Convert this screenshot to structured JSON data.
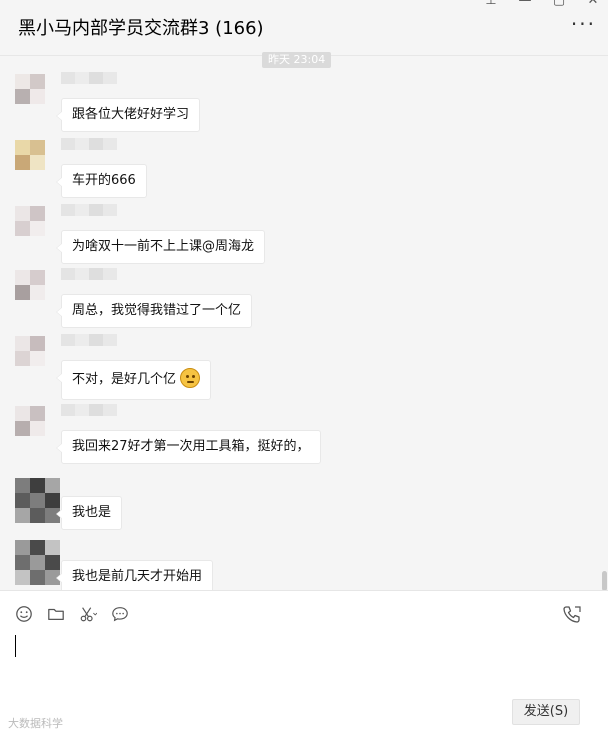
{
  "header": {
    "title": "黑小马内部学员交流群3 (166)",
    "more_label": "···"
  },
  "window_controls": {
    "pin": "⊥",
    "minimize": "—",
    "maximize": "▢",
    "close": "✕"
  },
  "chat": {
    "timestamp": "昨天 23:04",
    "messages": [
      {
        "text": "跟各位大佬好好学习",
        "avatar_colors": [
          "#ede8e6",
          "#d2c9c8",
          "#b8b0b0",
          "#efe9e9"
        ]
      },
      {
        "text": "车开的666",
        "avatar_colors": [
          "#e9d8a8",
          "#d8c091",
          "#c9a877",
          "#efe4c4"
        ]
      },
      {
        "text": "为啥双十一前不上上课@周海龙",
        "avatar_colors": [
          "#ebe6e6",
          "#cfc5c6",
          "#d8cfd0",
          "#f1eded"
        ]
      },
      {
        "text": "周总，我觉得我错过了一个亿",
        "avatar_colors": [
          "#ece7e7",
          "#d6cccd",
          "#a89f9f",
          "#f0ecec"
        ]
      },
      {
        "text": "不对，是好几个亿",
        "emoji": "thinking-emoji",
        "avatar_colors": [
          "#ebe6e6",
          "#c7bcbd",
          "#dcd4d4",
          "#f1eded"
        ]
      },
      {
        "text": "我回来27好才第一次用工具箱，挺好的，",
        "avatar_colors": [
          "#ebe6e6",
          "#c9c0c1",
          "#b7aeae",
          "#efeaea"
        ]
      },
      {
        "text": "我也是",
        "avatar_colors": [
          "#7d7d7d",
          "#3e3e3e",
          "#a6a6a6",
          "#5c5c5c"
        ]
      },
      {
        "text": "我也是前几天才开始用",
        "avatar_colors": [
          "#9a9a9a",
          "#4a4a4a",
          "#c3c3c3",
          "#6e6e6e"
        ]
      }
    ]
  },
  "composer": {
    "tools": [
      "emoji-icon",
      "folder-icon",
      "scissors-icon",
      "chat-bubble-icon"
    ],
    "send_label": "发送(S)",
    "watermark": "大数据科学"
  },
  "colors": {
    "background": "#f5f5f5",
    "bubble": "#ffffff",
    "input_bg": "#ffffff"
  }
}
